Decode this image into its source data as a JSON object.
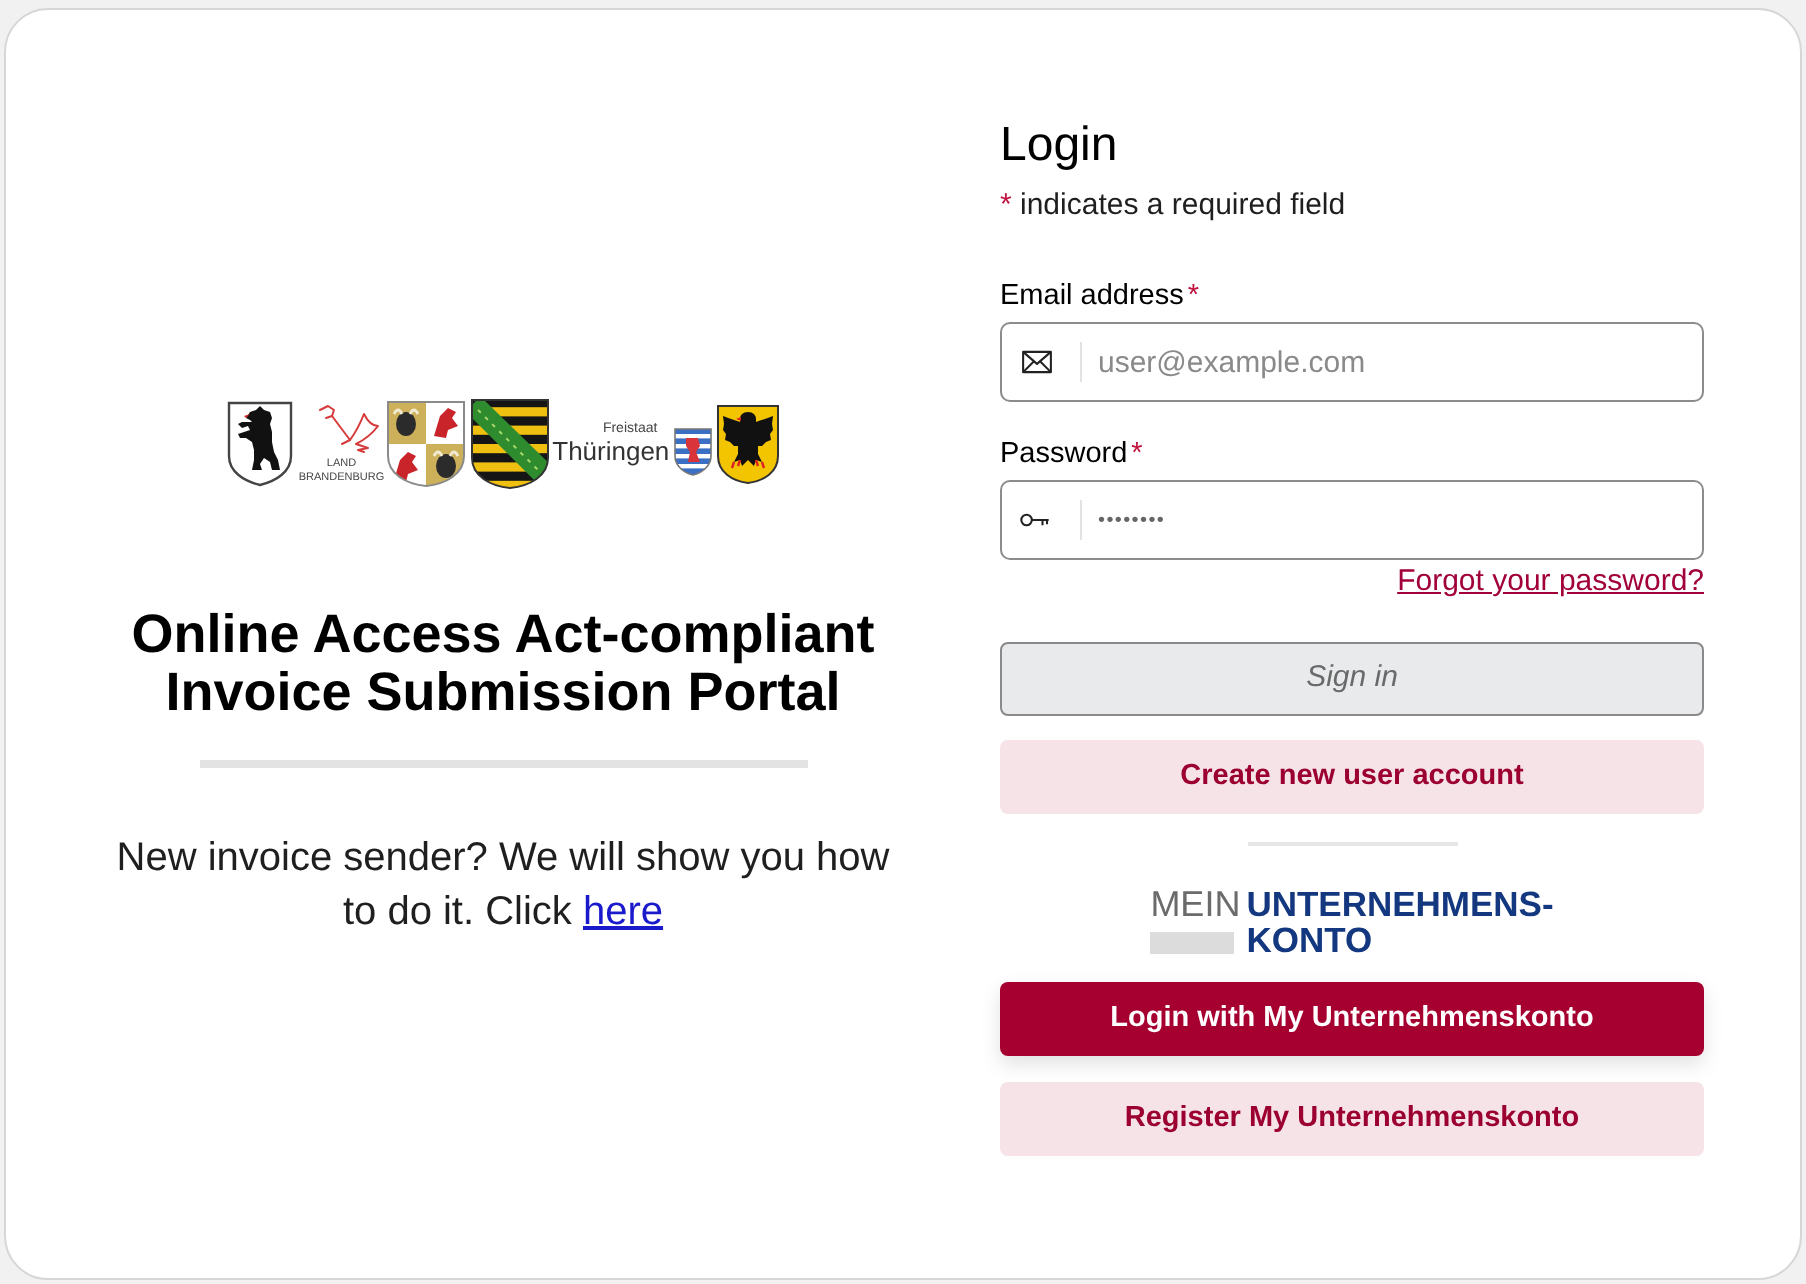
{
  "state_logos": [
    {
      "kind": "bear-crest"
    },
    {
      "kind": "eagle",
      "caption": [
        "LAND",
        "BRANDENBURG"
      ]
    },
    {
      "kind": "quartered-crest"
    },
    {
      "kind": "striped-crest"
    },
    {
      "kind": "barred-crest",
      "caption": [
        "Freistaat",
        "Thüringen"
      ]
    },
    {
      "kind": "eagle-crest"
    }
  ],
  "portal": {
    "title": "Online Access Act-compliant Invoice Submission Portal",
    "intro": "New invoice sender? We will show you how to do it. Click",
    "intro_link": "here"
  },
  "login": {
    "title": "Login",
    "required_mark": "*",
    "required_note": "indicates a required field",
    "fields": [
      {
        "kind": "email",
        "label": "Email address",
        "required": true,
        "placeholder": "user@example.com"
      },
      {
        "kind": "password",
        "label": "Password",
        "required": true,
        "value": "••••••••"
      }
    ],
    "forgot_link": "Forgot your password?",
    "buttons": [
      {
        "label": "Sign in",
        "kind": "outline",
        "disabled": true
      },
      {
        "label": "Create new user account",
        "kind": "soft",
        "disabled": false
      }
    ]
  },
  "unternehmenskonto": {
    "logo": {
      "word": "MEIN",
      "lines": [
        "UNTERNEHMENS-",
        "KONTO"
      ]
    },
    "buttons": [
      {
        "label": "Login with My Unternehmenskonto",
        "kind": "solid",
        "disabled": false
      },
      {
        "label": "Register My Unternehmenskonto",
        "kind": "soft",
        "disabled": false
      }
    ]
  }
}
